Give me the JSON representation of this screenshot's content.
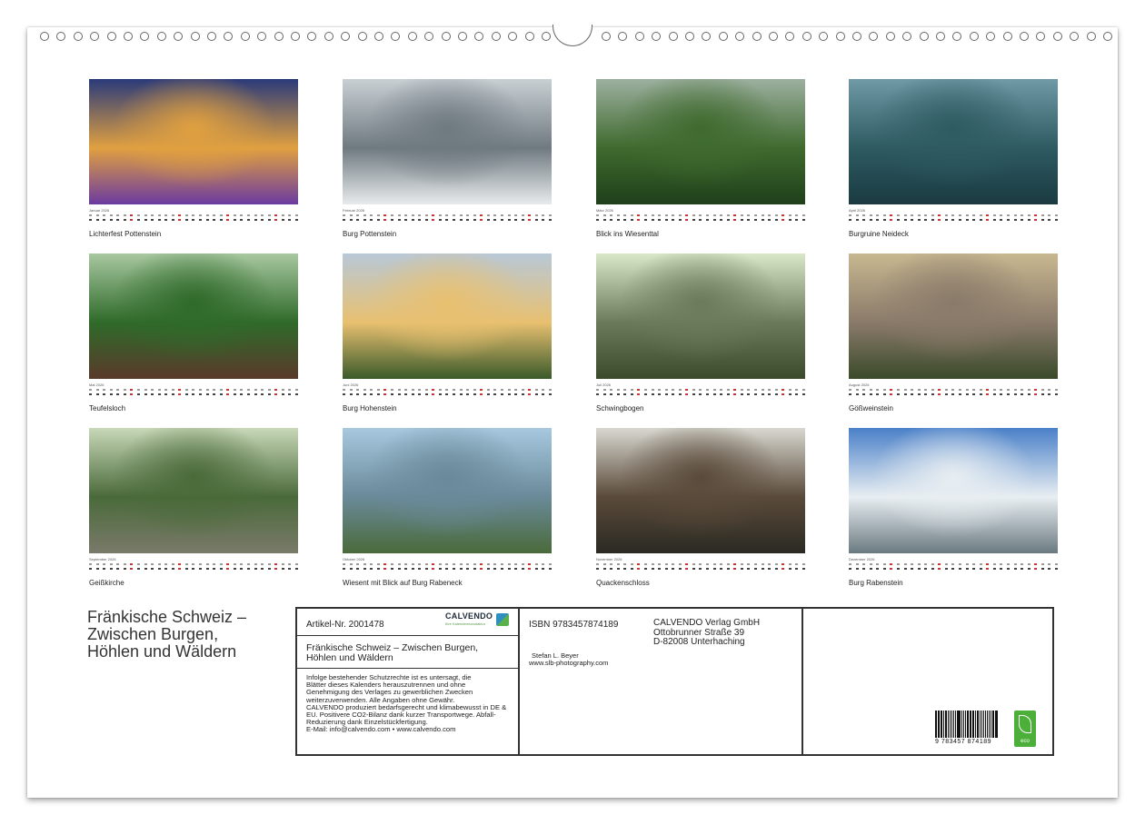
{
  "calendar": {
    "title_lines": [
      "Fränkische Schweiz –",
      "Zwischen Burgen,",
      "Höhlen und Wäldern"
    ],
    "months": [
      {
        "month_label": "Januar 2026",
        "caption": "Lichterfest Pottenstein",
        "icon": "festival-lights-photo",
        "palette": [
          "#2a3a7a",
          "#e0a040",
          "#6b3aa0"
        ]
      },
      {
        "month_label": "Februar 2026",
        "caption": "Burg Pottenstein",
        "icon": "misty-castle-photo",
        "palette": [
          "#c9d0d4",
          "#6f7a80",
          "#e8ebed"
        ]
      },
      {
        "month_label": "März 2026",
        "caption": "Blick ins Wiesenttal",
        "icon": "valley-photo",
        "palette": [
          "#9db0a0",
          "#3f6a2e",
          "#1f3f1a"
        ]
      },
      {
        "month_label": "April 2026",
        "caption": "Burgruine Neideck",
        "icon": "ruin-photo",
        "palette": [
          "#6f9aa6",
          "#2e5a62",
          "#1a3a40"
        ]
      },
      {
        "month_label": "Mai 2026",
        "caption": "Teufelsloch",
        "icon": "forest-ferns-photo",
        "palette": [
          "#a8c8a0",
          "#2f6a2a",
          "#5a3a2a"
        ]
      },
      {
        "month_label": "Juni 2026",
        "caption": "Burg Hohenstein",
        "icon": "castle-sunset-photo",
        "palette": [
          "#b8c8d8",
          "#e8c070",
          "#3a5a2a"
        ]
      },
      {
        "month_label": "Juli 2026",
        "caption": "Schwingbogen",
        "icon": "rock-arch-photo",
        "palette": [
          "#d8e8c8",
          "#6a7a5a",
          "#3a4a2a"
        ]
      },
      {
        "month_label": "August 2026",
        "caption": "Gößweinstein",
        "icon": "town-basilica-photo",
        "palette": [
          "#c8b890",
          "#8a7a6a",
          "#3a4a2a"
        ]
      },
      {
        "month_label": "September 2026",
        "caption": "Geißkirche",
        "icon": "forest-rock-photo",
        "palette": [
          "#c8d8b8",
          "#4a6a3a",
          "#7a7a6a"
        ]
      },
      {
        "month_label": "Oktober 2026",
        "caption": "Wiesent mit Blick auf Burg Rabeneck",
        "icon": "river-fog-photo",
        "palette": [
          "#a8c8e0",
          "#6a8a9a",
          "#4a6a3a"
        ]
      },
      {
        "month_label": "November 2026",
        "caption": "Quackenschloss",
        "icon": "icy-cave-photo",
        "palette": [
          "#d8d8d0",
          "#5a4a3a",
          "#2a2a22"
        ]
      },
      {
        "month_label": "Dezember 2026",
        "caption": "Burg Rabenstein",
        "icon": "winter-castle-photo",
        "palette": [
          "#4a80c8",
          "#e8eef2",
          "#6a7a80"
        ]
      }
    ]
  },
  "info": {
    "article": "Artikel-Nr. 2001478",
    "logo_text": "CALVENDO",
    "logo_sub": "Ihre Kalendermanufaktur",
    "title_lines": [
      "Fränkische Schweiz – Zwischen Burgen,",
      "Höhlen und Wäldern"
    ],
    "legal_lines": [
      "Infolge bestehender Schutzrechte ist es untersagt, die",
      "Blätter dieses Kalenders herauszutrennen und ohne",
      "Genehmigung des Verlages zu gewerblichen Zwecken",
      "weiterzuverwenden. Alle Angaben ohne Gewähr.",
      "CALVENDO produziert bedarfsgerecht und klimabewusst in DE &",
      "EU. Positivere CO2-Bilanz dank kurzer Transportwege. Abfall-",
      "Reduzierung dank Einzelstückfertigung.",
      "E-Mail: info@calvendo.com • www.calvendo.com"
    ],
    "isbn": "ISBN 9783457874189",
    "publisher_lines": [
      "CALVENDO Verlag GmbH",
      "Ottobrunner Straße 39",
      "D-82008 Unterhaching"
    ],
    "author_name": "Stefan L. Beyer",
    "author_web": "www.slb-photography.com",
    "barcode_number": "9 783457 874189",
    "eco_label": "eco"
  }
}
